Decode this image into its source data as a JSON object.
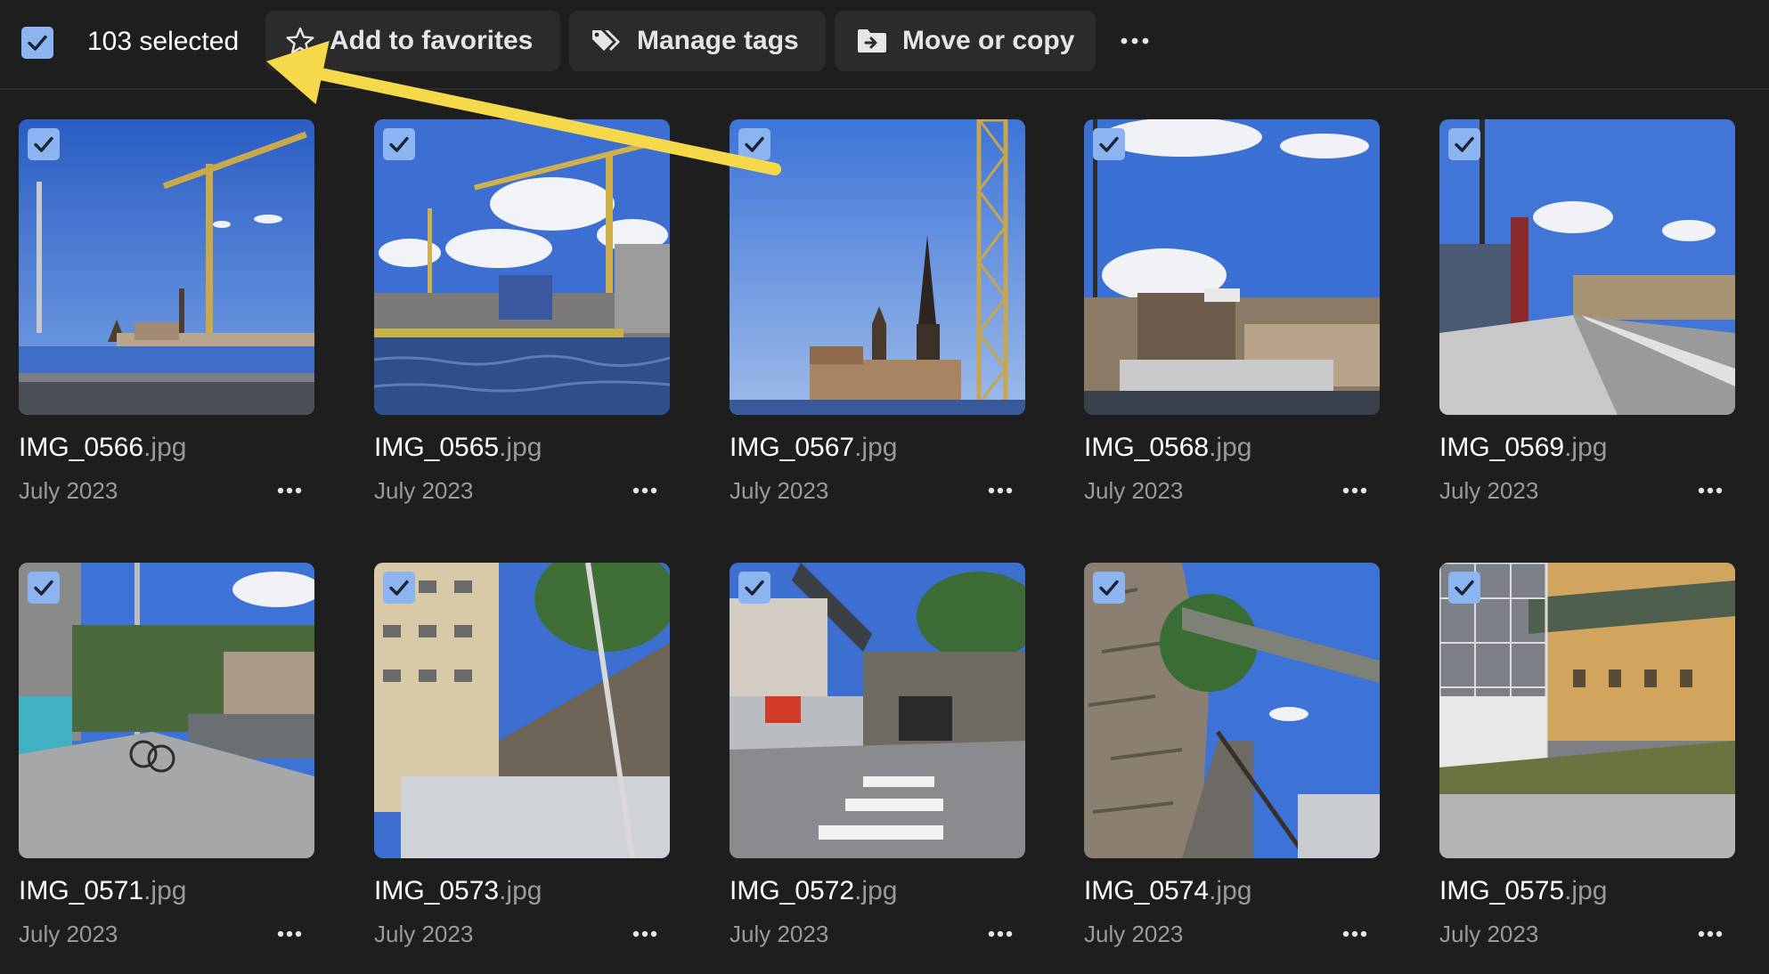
{
  "toolbar": {
    "selected_count": "103 selected",
    "add_to_favorites_label": "Add to favorites",
    "manage_tags_label": "Manage tags",
    "move_or_copy_label": "Move or copy",
    "more_icon": "more-horizontal-icon"
  },
  "photos": [
    {
      "name": "IMG_0566",
      "ext": ".jpg",
      "date": "July 2023",
      "selected": true
    },
    {
      "name": "IMG_0565",
      "ext": ".jpg",
      "date": "July 2023",
      "selected": true
    },
    {
      "name": "IMG_0567",
      "ext": ".jpg",
      "date": "July 2023",
      "selected": true
    },
    {
      "name": "IMG_0568",
      "ext": ".jpg",
      "date": "July 2023",
      "selected": true
    },
    {
      "name": "IMG_0569",
      "ext": ".jpg",
      "date": "July 2023",
      "selected": true
    },
    {
      "name": "IMG_0571",
      "ext": ".jpg",
      "date": "July 2023",
      "selected": true
    },
    {
      "name": "IMG_0573",
      "ext": ".jpg",
      "date": "July 2023",
      "selected": true
    },
    {
      "name": "IMG_0572",
      "ext": ".jpg",
      "date": "July 2023",
      "selected": true
    },
    {
      "name": "IMG_0574",
      "ext": ".jpg",
      "date": "July 2023",
      "selected": true
    },
    {
      "name": "IMG_0575",
      "ext": ".jpg",
      "date": "July 2023",
      "selected": true
    }
  ],
  "colors": {
    "background": "#1e1e1e",
    "button_background": "#2b2b2b",
    "checkbox_accent": "#8bb4f0",
    "annotation_arrow": "#f5d94a",
    "secondary_text": "#9a9a9a"
  }
}
